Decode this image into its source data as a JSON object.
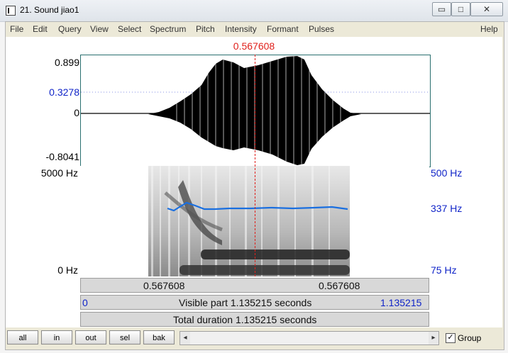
{
  "window": {
    "title": "21. Sound jiao1",
    "controls": {
      "minimize": "▭",
      "maximize": "□",
      "close": "✕"
    }
  },
  "menu": [
    "File",
    "Edit",
    "Query",
    "View",
    "Select",
    "Spectrum",
    "Pitch",
    "Intensity",
    "Formant",
    "Pulses",
    "Help"
  ],
  "cursor_time": "0.567608",
  "waveform": {
    "y_top": "0.899",
    "y_selected": "0.3278",
    "y_zero": "0",
    "y_bottom": "-0.8041"
  },
  "spectrogram": {
    "left_top": "5000 Hz",
    "left_bottom": "0 Hz",
    "right_top": "500 Hz",
    "right_mid": "337 Hz",
    "right_bottom": "75 Hz"
  },
  "time_bar": {
    "left": "0.567608",
    "right": "0.567608"
  },
  "visible_bar": {
    "start": "0",
    "label": "Visible part 1.135215 seconds",
    "end": "1.135215"
  },
  "total_bar": {
    "label": "Total duration 1.135215 seconds"
  },
  "toolbar": {
    "all": "all",
    "in": "in",
    "out": "out",
    "sel": "sel",
    "bak": "bak"
  },
  "scroll": {
    "left_arrow": "◂",
    "right_arrow": "▸"
  },
  "group": {
    "label": "Group",
    "checked": true,
    "check_mark": "✓"
  },
  "colors": {
    "cursor": "#e0201b",
    "pitch_line": "#1a6fe0",
    "axis_blue": "#1024c8"
  }
}
